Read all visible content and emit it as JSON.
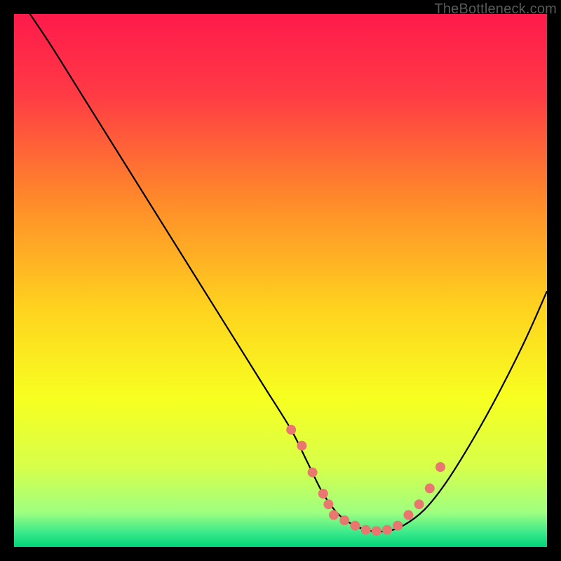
{
  "attribution": "TheBottleneck.com",
  "chart_data": {
    "type": "line",
    "title": "",
    "xlabel": "",
    "ylabel": "",
    "xlim": [
      0,
      100
    ],
    "ylim": [
      0,
      100
    ],
    "grid": false,
    "legend": false,
    "background_gradient": {
      "stops": [
        {
          "offset": 0.0,
          "color": "#ff1a4b"
        },
        {
          "offset": 0.15,
          "color": "#ff3a45"
        },
        {
          "offset": 0.35,
          "color": "#ff8a2a"
        },
        {
          "offset": 0.55,
          "color": "#ffd21f"
        },
        {
          "offset": 0.72,
          "color": "#f7ff20"
        },
        {
          "offset": 0.85,
          "color": "#d7ff4a"
        },
        {
          "offset": 0.935,
          "color": "#9fff80"
        },
        {
          "offset": 0.975,
          "color": "#35e88a"
        },
        {
          "offset": 1.0,
          "color": "#00d477"
        }
      ]
    },
    "series": [
      {
        "name": "bottleneck-curve",
        "color": "#000000",
        "x": [
          3,
          7,
          12,
          17,
          22,
          27,
          32,
          37,
          42,
          47,
          52,
          55,
          58,
          61,
          64,
          67,
          70,
          73,
          77,
          81,
          86,
          91,
          96,
          100
        ],
        "y": [
          100,
          94,
          86,
          78,
          70,
          62,
          54,
          46,
          38,
          30,
          22,
          16,
          10,
          6,
          4,
          3,
          3,
          4,
          7,
          12,
          20,
          29,
          39,
          48
        ]
      }
    ],
    "markers": {
      "name": "highlight-dots",
      "color": "#e9766f",
      "radius": 7,
      "x": [
        52,
        54,
        56,
        58,
        59,
        60,
        62,
        64,
        66,
        68,
        70,
        72,
        74,
        76,
        78,
        80
      ],
      "y": [
        22,
        19,
        14,
        10,
        8,
        6,
        5,
        4,
        3.2,
        3,
        3.2,
        4,
        6,
        8,
        11,
        15
      ]
    }
  }
}
